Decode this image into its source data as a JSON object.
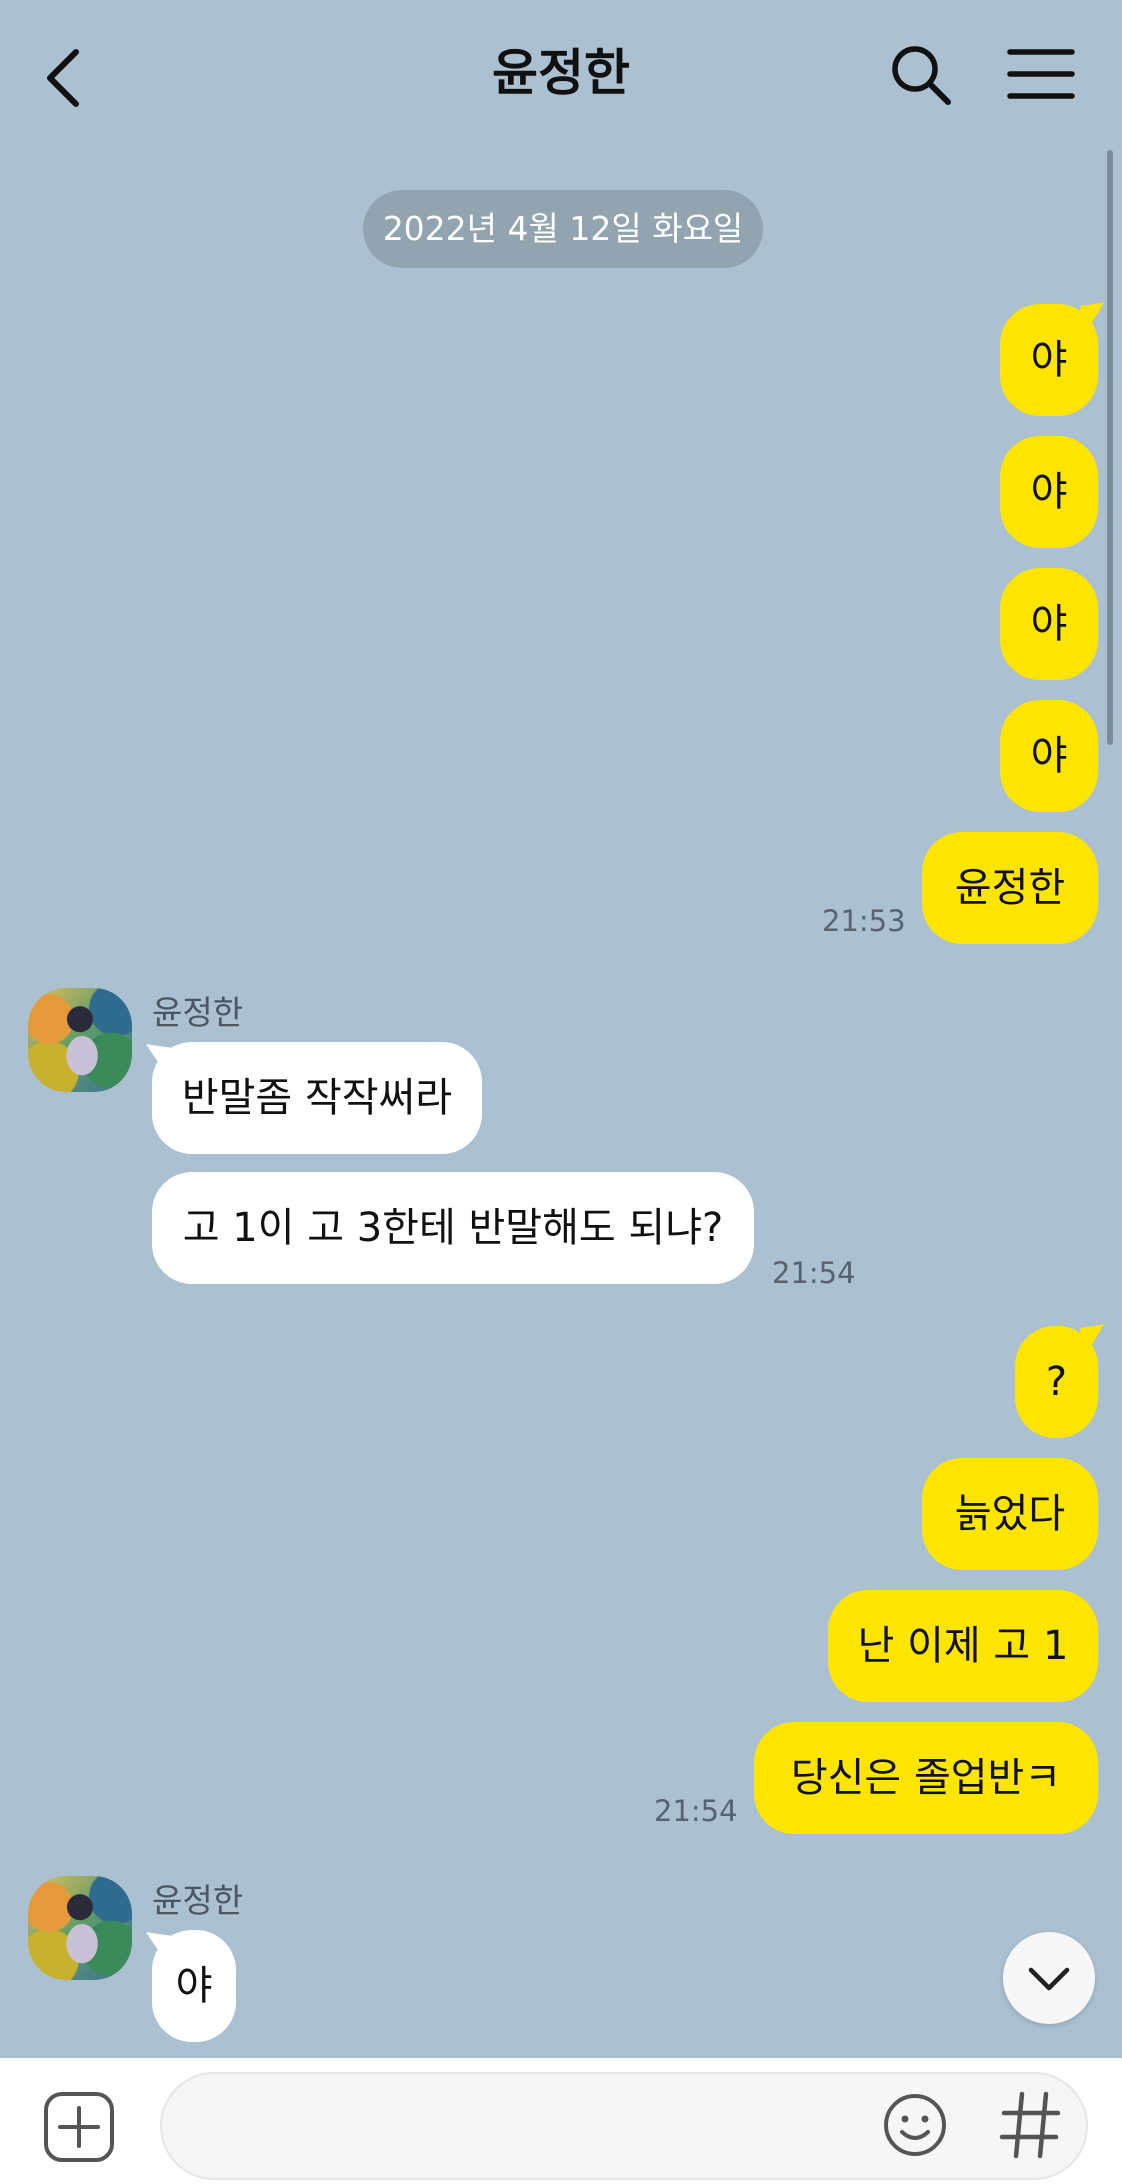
{
  "header": {
    "title": "윤정한",
    "back_icon": "chevron-left-icon",
    "search_icon": "search-icon",
    "menu_icon": "hamburger-menu-icon"
  },
  "date_divider": "2022년 4월 12일 화요일",
  "colors": {
    "background": "#abc1d1",
    "my_bubble": "#fee500",
    "their_bubble": "#ffffff",
    "date_pill": "#93a4b1"
  },
  "messages": {
    "m1": "야",
    "m2": "야",
    "m3": "야",
    "m4": "야",
    "m5": "윤정한",
    "t1": "21:53",
    "sender1": "윤정한",
    "r1": "반말좀 작작써라",
    "r2": "고 1이 고 3한테 반말해도 되냐?",
    "t2": "21:54",
    "m6": "?",
    "m7": "늙었다",
    "m8": "난 이제 고 1",
    "m9": "당신은 졸업반ㅋ",
    "t3": "21:54",
    "sender2": "윤정한",
    "r3": "야"
  },
  "input": {
    "value": "",
    "placeholder": "",
    "attach_icon": "plus-square-icon",
    "emoji_icon": "smiley-icon",
    "hash_icon": "hashtag-icon"
  },
  "scroll_down_icon": "chevron-down-icon"
}
